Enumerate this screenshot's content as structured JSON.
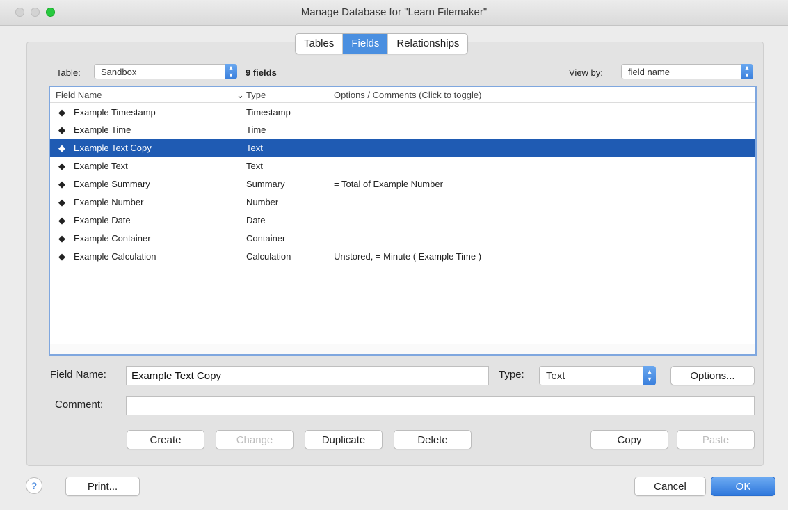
{
  "window": {
    "title": "Manage Database for \"Learn Filemaker\""
  },
  "tabs": [
    {
      "label": "Tables"
    },
    {
      "label": "Fields"
    },
    {
      "label": "Relationships"
    }
  ],
  "table_select": {
    "label": "Table:",
    "value": "Sandbox"
  },
  "field_count": "9 fields",
  "view_by": {
    "label": "View by:",
    "value": "field name"
  },
  "list": {
    "headers": {
      "name": "Field Name",
      "sort_indicator": "⌄",
      "type": "Type",
      "options": "Options / Comments   (Click to toggle)"
    },
    "rows": [
      {
        "name": "Example Timestamp",
        "type": "Timestamp",
        "options": ""
      },
      {
        "name": "Example Time",
        "type": "Time",
        "options": ""
      },
      {
        "name": "Example Text Copy",
        "type": "Text",
        "options": ""
      },
      {
        "name": "Example Text",
        "type": "Text",
        "options": ""
      },
      {
        "name": "Example Summary",
        "type": "Summary",
        "options": "= Total of Example Number"
      },
      {
        "name": "Example Number",
        "type": "Number",
        "options": ""
      },
      {
        "name": "Example Date",
        "type": "Date",
        "options": ""
      },
      {
        "name": "Example Container",
        "type": "Container",
        "options": ""
      },
      {
        "name": "Example Calculation",
        "type": "Calculation",
        "options": "Unstored, = Minute ( Example Time )"
      }
    ],
    "selected_index": 2
  },
  "form": {
    "field_name_label": "Field Name:",
    "field_name_value": "Example Text Copy",
    "type_label": "Type:",
    "type_value": "Text",
    "options_button": "Options...",
    "comment_label": "Comment:",
    "comment_value": ""
  },
  "actions": {
    "create": "Create",
    "change": "Change",
    "duplicate": "Duplicate",
    "delete": "Delete",
    "copy": "Copy",
    "paste": "Paste"
  },
  "footer": {
    "help": "?",
    "print": "Print...",
    "cancel": "Cancel",
    "ok": "OK"
  },
  "colors": {
    "accent": "#3a7fdc",
    "selection": "#1f5bb3"
  }
}
